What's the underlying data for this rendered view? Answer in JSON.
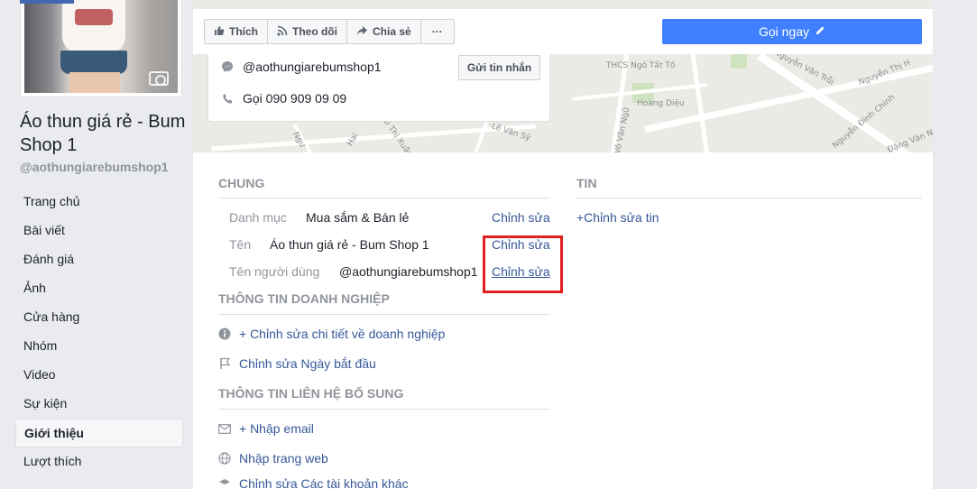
{
  "left": {
    "page_name": "Áo thun giá rẻ - Bum Shop 1",
    "page_handle": "@aothungiarebumshop1",
    "nav_items": [
      {
        "label": "Trang chủ"
      },
      {
        "label": "Bài viết"
      },
      {
        "label": "Đánh giá"
      },
      {
        "label": "Ảnh"
      },
      {
        "label": "Cửa hàng"
      },
      {
        "label": "Nhóm"
      },
      {
        "label": "Video"
      },
      {
        "label": "Sự kiện"
      },
      {
        "label": "Giới thiệu",
        "active": true
      },
      {
        "label": "Lượt thích"
      }
    ]
  },
  "topbar": {
    "like_label": "Thích",
    "follow_label": "Theo dõi",
    "share_label": "Chia sẻ",
    "more_label": "···",
    "call_label": "Gọi ngay"
  },
  "contact": {
    "messenger_handle": "@aothungiarebumshop1",
    "send_message_label": "Gửi tin nhắn",
    "phone_label": "Gọi 090 909 09 09"
  },
  "map": {
    "labels": [
      "THCS Ngô Tất Tố",
      "Nguyễn Văn Trỗi",
      "Nguyễn Thị H",
      "Hoàng Diệu",
      "Lê Văn Sỹ",
      "Bùi Thị Xuân",
      "Võ Văn Ngữ",
      "Nguyễn Đình Chính",
      "Đặng Văn Ngữ",
      "Hai",
      "Ngư"
    ]
  },
  "general": {
    "heading": "CHUNG",
    "category_label": "Danh mục",
    "category_value": "Mua sắm & Bán lẻ",
    "category_edit": "Chỉnh sửa",
    "name_label": "Tên",
    "name_value": "Áo thun giá rẻ - Bum Shop 1",
    "name_edit": "Chỉnh sửa",
    "username_label": "Tên người dùng",
    "username_value": "@aothungiarebumshop1",
    "username_edit": "Chỉnh sửa"
  },
  "business": {
    "heading": "THÔNG TIN DOANH NGHIỆP",
    "edit_details": "+ Chỉnh sửa chi tiết về doanh nghiệp",
    "edit_start_date": "Chỉnh sửa Ngày bắt đầu"
  },
  "extra_contact": {
    "heading": "THÔNG TIN LIÊN HỆ BỔ SUNG",
    "email": "+ Nhập email",
    "website": "Nhập trang web",
    "other_accounts": "Chỉnh sửa Các tài khoản khác"
  },
  "news": {
    "heading": "TIN",
    "edit_news": "+Chỉnh sửa tin"
  },
  "colors": {
    "accent": "#4080ff",
    "link": "#365899",
    "highlight": "#e02020"
  }
}
